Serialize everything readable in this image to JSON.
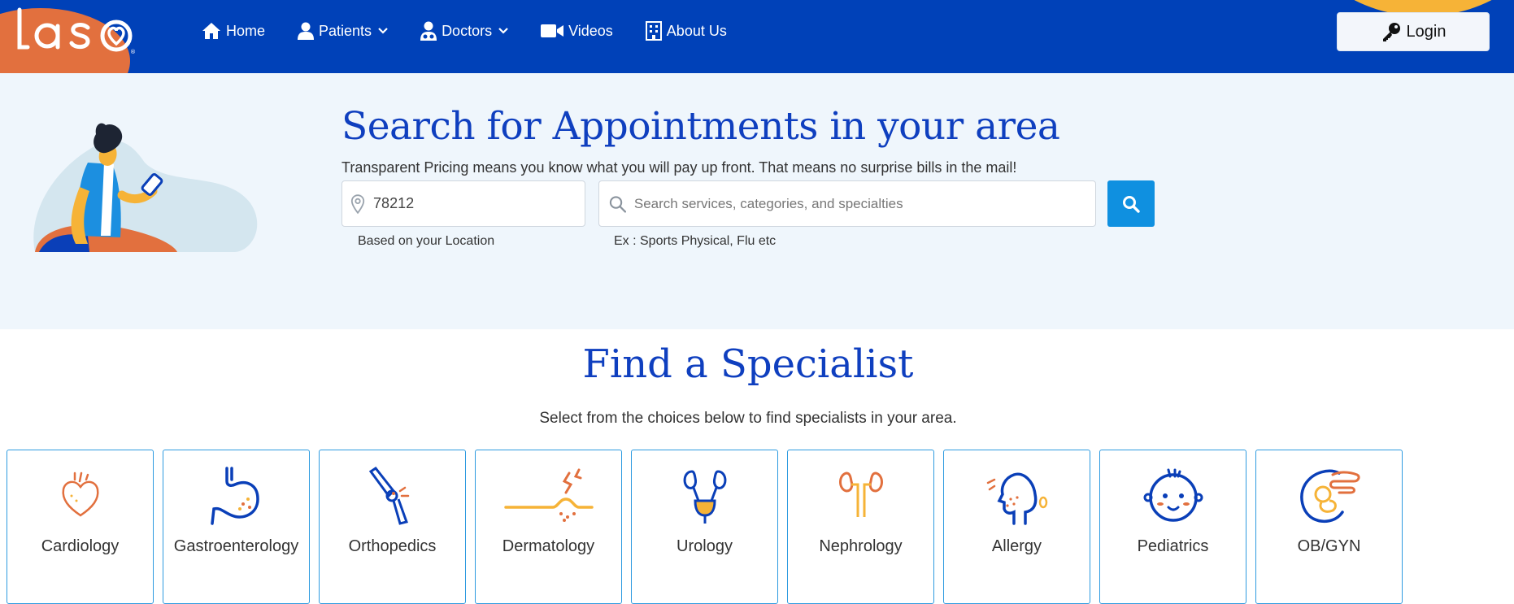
{
  "colors": {
    "nav_bg": "#0041b8",
    "accent_orange": "#e2703e",
    "accent_yellow": "#f6b337",
    "title_blue": "#0f3fbf",
    "search_button": "#0f90e0",
    "hero_bg": "#eff6fc",
    "card_border": "#2e9be0"
  },
  "header": {
    "logo_text": "laso",
    "nav": [
      {
        "label": "Home",
        "icon": "home-icon"
      },
      {
        "label": "Patients",
        "icon": "user-icon",
        "dropdown": true
      },
      {
        "label": "Doctors",
        "icon": "doctor-icon",
        "dropdown": true
      },
      {
        "label": "Videos",
        "icon": "video-camera-icon"
      },
      {
        "label": "About Us",
        "icon": "building-icon"
      }
    ],
    "login_label": "Login",
    "login_icon": "key-icon"
  },
  "hero": {
    "title": "Search for Appointments in your area",
    "subtitle": "Transparent Pricing means you know what you will pay up front. That means no surprise bills in the mail!",
    "location": {
      "value": "78212",
      "hint": "Based on your Location",
      "icon": "map-pin-icon"
    },
    "service": {
      "placeholder": "Search services, categories, and specialties",
      "hint": "Ex : Sports Physical, Flu etc",
      "icon": "search-icon"
    },
    "search_button_icon": "search-icon"
  },
  "specialists": {
    "title": "Find a Specialist",
    "subtitle": "Select from the choices below to find specialists in your area.",
    "items": [
      {
        "label": "Cardiology",
        "icon": "heart-icon"
      },
      {
        "label": "Gastroenterology",
        "icon": "stomach-icon"
      },
      {
        "label": "Orthopedics",
        "icon": "bone-joint-icon"
      },
      {
        "label": "Dermatology",
        "icon": "skin-icon"
      },
      {
        "label": "Urology",
        "icon": "bladder-icon"
      },
      {
        "label": "Nephrology",
        "icon": "kidney-icon"
      },
      {
        "label": "Allergy",
        "icon": "allergy-face-icon"
      },
      {
        "label": "Pediatrics",
        "icon": "baby-face-icon"
      },
      {
        "label": "OB/GYN",
        "icon": "fetus-icon"
      }
    ]
  }
}
